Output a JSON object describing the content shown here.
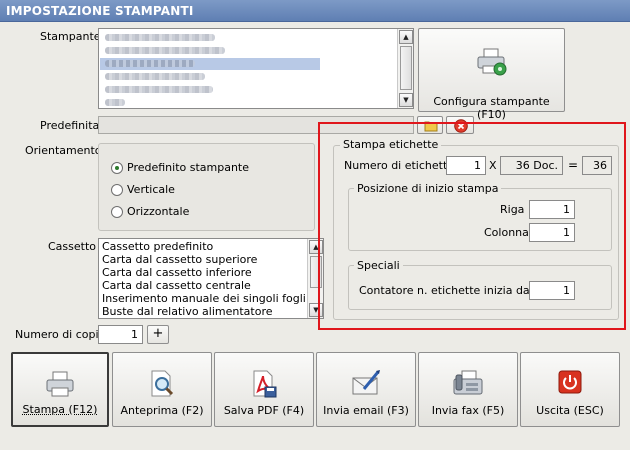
{
  "window": {
    "title": "IMPOSTAZIONE STAMPANTI"
  },
  "printer": {
    "label": "Stampante",
    "configure_button": "Configura stampante (F10)",
    "default_label": "Predefinita",
    "default_value": ""
  },
  "orientation": {
    "label": "Orientamento",
    "options": [
      "Predefinito stampante",
      "Verticale",
      "Orizzontale"
    ],
    "selected": "Predefinito stampante"
  },
  "tray": {
    "label": "Cassetto",
    "items": [
      "Cassetto predefinito",
      "Carta dal cassetto superiore",
      "Carta dal cassetto inferiore",
      "Carta dal cassetto centrale",
      "Inserimento manuale dei singoli fogli",
      "Buste dal relativo alimentatore"
    ]
  },
  "copies": {
    "label": "Numero di copie",
    "value": "1",
    "increment_label": "+"
  },
  "labels": {
    "group_title": "Stampa etichette",
    "count_label": "Numero di etichette",
    "count_value": "1",
    "times_sign": "X",
    "docs_value": "36 Doc.",
    "equals_sign": "=",
    "total_value": "36",
    "start_position": {
      "title": "Posizione di inizio stampa",
      "row_label": "Riga",
      "row_value": "1",
      "column_label": "Colonna",
      "column_value": "1"
    },
    "special": {
      "title": "Speciali",
      "counter_label": "Contatore n. etichette inizia da",
      "counter_value": "1"
    }
  },
  "actions": {
    "print": "Stampa (F12)",
    "preview": "Anteprima (F2)",
    "save_pdf": "Salva PDF (F4)",
    "send_email": "Invia email (F3)",
    "send_fax": "Invia fax (F5)",
    "exit": "Uscita (ESC)"
  },
  "colors": {
    "title_bar": "#6a88bb",
    "highlight_frame": "#e0161c",
    "selection": "#b8c9e6"
  }
}
